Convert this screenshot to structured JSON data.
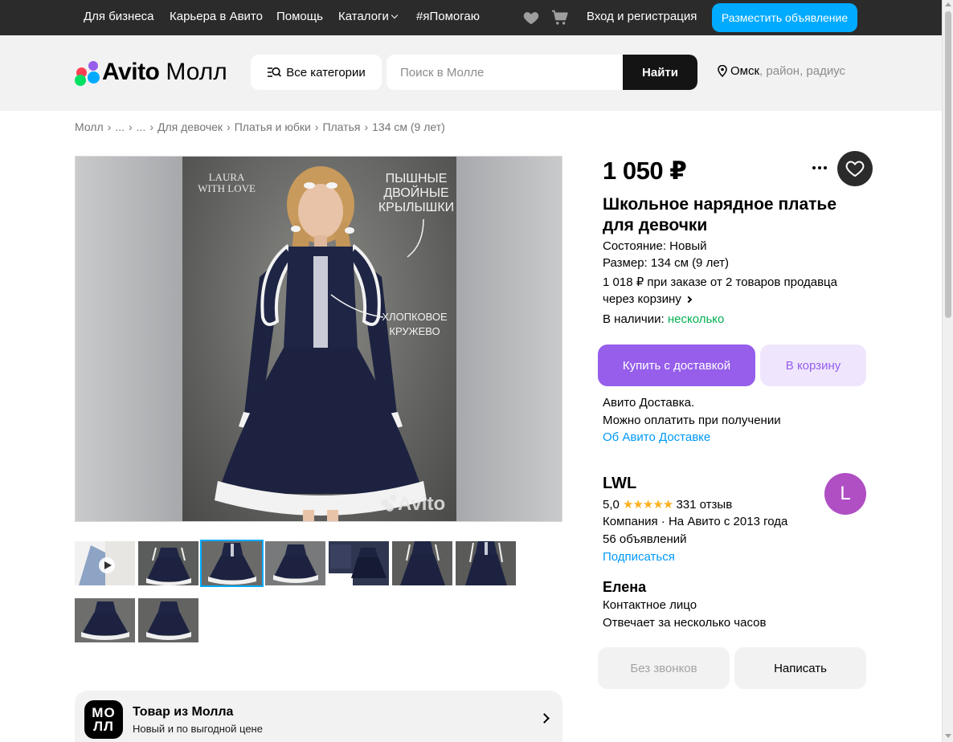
{
  "topbar": {
    "links": [
      "Для бизнеса",
      "Карьера в Авито",
      "Помощь",
      "Каталоги",
      "#яПомогаю"
    ],
    "login": "Вход и регистрация",
    "post_button": "Разместить объявление",
    "icons": [
      "heart-icon",
      "cart-icon",
      "chevron-down-icon"
    ]
  },
  "header": {
    "logo_brand": "Avito",
    "logo_suffix": "Молл",
    "categories_button": "Все категории",
    "search": {
      "placeholder": "Поиск в Молле",
      "value": ""
    },
    "search_button": "Найти",
    "location": {
      "city": "Омск",
      "suffix": ", район, радиус"
    }
  },
  "breadcrumb": [
    "Молл",
    "...",
    "...",
    "Для девочек",
    "Платья и юбки",
    "Платья",
    "134 см (9 лет)"
  ],
  "gallery": {
    "overlay_text": {
      "brand_line1": "LAURA",
      "brand_line2": "WITH LOVE",
      "caption_top_1": "ПЫШНЫЕ",
      "caption_top_2": "ДВОЙНЫЕ",
      "caption_top_3": "КРЫЛЫШКИ",
      "caption_mid_1": "ХЛОПКОВОЕ",
      "caption_mid_2": "КРУЖЕВО",
      "watermark": "Avito"
    },
    "thumbnail_count": 9,
    "active_thumbnail_index": 2
  },
  "product": {
    "price": "1 050 ₽",
    "title": "Школьное нарядное платье для девочки",
    "condition": "Состояние: Новый",
    "size": "Размер: 134 см (9 лет)",
    "bulk_line1": "1 018 ₽ при заказе от 2 товаров продавца",
    "bulk_line2": "через корзину",
    "availability_label": "В наличии:",
    "availability_value": "несколько",
    "buy_button": "Купить с доставкой",
    "cart_button": "В корзину",
    "delivery_line1": "Авито Доставка.",
    "delivery_line2": "Можно оплатить при получении",
    "delivery_link": "Об Авито Доставке"
  },
  "seller": {
    "name": "LWL",
    "avatar_letter": "L",
    "rating": "5,0",
    "stars": "★★★★★",
    "reviews": "331 отзыв",
    "company": "Компания · На Авито с 2013 года",
    "listings": "56 объявлений",
    "subscribe": "Подписаться",
    "contact_name": "Елена",
    "contact_role": "Контактное лицо",
    "response_time": "Отвечает за несколько часов",
    "no_calls_button": "Без звонков",
    "write_button": "Написать"
  },
  "mall_banner": {
    "logo_line1": "МО",
    "logo_line2": "ЛЛ",
    "title": "Товар из Молла",
    "subtitle": "Новый и по выгодной цене"
  },
  "colors": {
    "accent_blue": "#00aaff",
    "buy_purple": "#965eeb",
    "in_stock_green": "#02b053",
    "link_blue": "#0099f7",
    "star_yellow": "#ffb021",
    "avatar_purple": "#b04ec4"
  }
}
